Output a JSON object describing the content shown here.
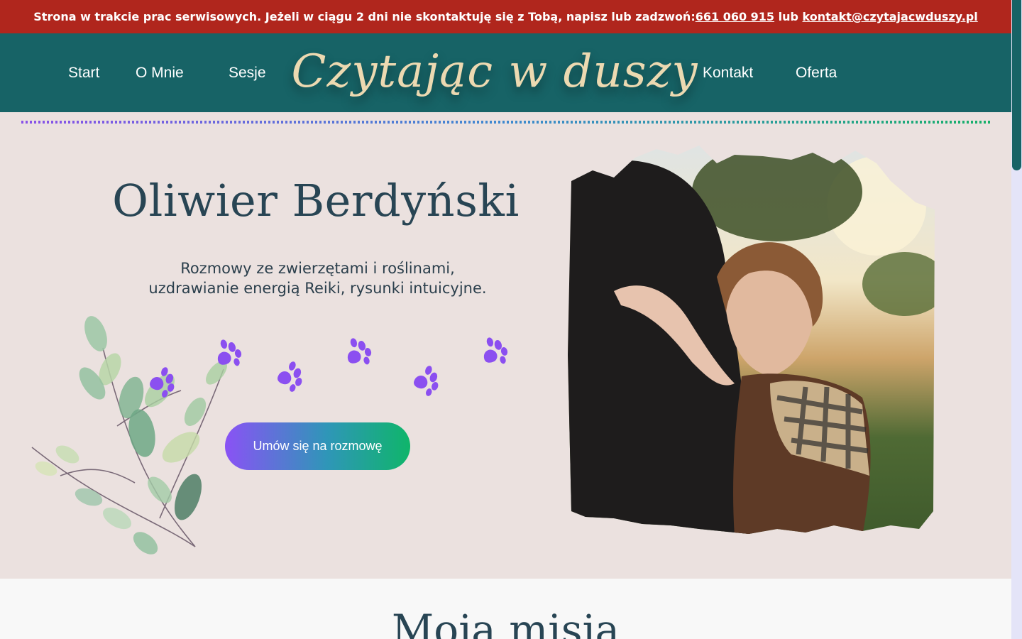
{
  "banner": {
    "text_before": "Strona w trakcie prac serwisowych. Jeżeli w ciągu 2 dni nie skontaktuję się z Tobą, napisz lub zadzwoń: ",
    "phone": "661 060 915",
    "text_middle": " lub ",
    "email": "kontakt@czytajacwduszy.pl"
  },
  "nav": {
    "start": "Start",
    "about": "O Mnie",
    "sessions": "Sesje",
    "logo": "Czytając w duszy",
    "contact": "Kontakt",
    "offer": "Oferta"
  },
  "hero": {
    "name": "Oliwier Berdyński",
    "subtitle_line1": "Rozmowy ze zwierzętami i roślinami,",
    "subtitle_line2": "uzdrawianie energią Reiki, rysunki intuicyjne.",
    "cta_label": "Umów się na rozmowę"
  },
  "mission": {
    "title": "Moja misja"
  },
  "colors": {
    "banner": "#b0261d",
    "header": "#176366",
    "logo": "#ecd9b1",
    "hero_bg": "#ebe1df",
    "heading": "#284554",
    "paw": "#8b4ff0",
    "cta_start": "#8a52f5",
    "cta_end": "#0fb56a"
  },
  "icons": {
    "paw": "paw-print-icon",
    "leaves": "watercolor-leaves-illustration"
  }
}
